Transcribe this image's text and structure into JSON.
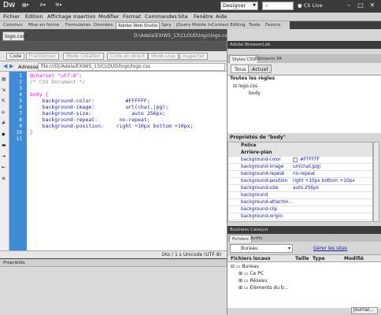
{
  "app": {
    "logo": "Dw",
    "workspace": "Designer",
    "cs_live": "CS Live"
  },
  "menu": [
    "Fichier",
    "Edition",
    "Affichage",
    "Insertion",
    "Modifier",
    "Format",
    "Commandes",
    "Site",
    "Fenêtre",
    "Aide"
  ],
  "insert_tabs": [
    "Commun",
    "Mise en forme",
    "Formulaires",
    "Données",
    "Adobe Web Studio",
    "Spry",
    "jQuery Mobile",
    "InContext Editing",
    "Texte",
    "Favoris"
  ],
  "insert_active_index": 4,
  "document": {
    "tab": "logo.css*",
    "path": "D:\\Adela\\EXIWS_13\\CLOUD\\logo\\logo.css",
    "view_buttons": [
      "Code",
      "Fractionner",
      "Mode Création",
      "Code en direct",
      "Mode Live",
      "Inspecter"
    ],
    "address_label": "Adresse :",
    "address_value": "file:///D|/Adela/EXIWS_13/CLOUD/logo/logo.css",
    "lines": [
      "1",
      "2",
      "3",
      "4",
      "5",
      "6",
      "7",
      "8",
      "9",
      "10",
      "11"
    ],
    "code": {
      "charset": "@charset \"utf-8\";",
      "comment": "/* CSS Document */",
      "selector": "body {",
      "p1": "    background-color:          #FFFFFF;",
      "p2": "    background-image:          url(chat.jpg);",
      "p3": "    background-size:             auto 256px;",
      "p4": "    background-repeat:       no-repeat;",
      "p5": "    background-position:    right +10px bottom +10px;",
      "close": "}"
    },
    "status": "1Ko / 1 s  Unicode (UTF-8)"
  },
  "properties_panel": {
    "title": "Propriétés"
  },
  "right_panel": {
    "browserlab": "Adobe BrowserLab",
    "tabs": [
      "Styles CSS",
      "Éléments PA"
    ],
    "toggle_all": "Tous",
    "toggle_current": "Actuel",
    "rules_title": "Toutes les règles",
    "rule_file": "logo.css",
    "rule_child": "body",
    "props_title": "Propriétés de \"body\"",
    "props": [
      {
        "name": "Police",
        "value": "",
        "cat": true
      },
      {
        "name": "Arrière-plan",
        "value": "",
        "cat": true
      },
      {
        "name": "background-color",
        "value": "#FFFFFF"
      },
      {
        "name": "background-image",
        "value": "url(chat.jpg)"
      },
      {
        "name": "background-repeat",
        "value": "no-repeat"
      },
      {
        "name": "background-position",
        "value": "right +10px bottom +10px"
      },
      {
        "name": "background-size",
        "value": "auto 256px"
      },
      {
        "name": "background",
        "value": ""
      },
      {
        "name": "background-attachm...",
        "value": ""
      },
      {
        "name": "background-clip",
        "value": ""
      },
      {
        "name": "background-origin",
        "value": ""
      }
    ],
    "business_catalyst": "Business Catalyst",
    "files_tabs": [
      "Fichiers",
      "Actifs"
    ],
    "files_select": "Bureau",
    "manage_sites": "Gérer les sites",
    "files_headers": [
      "Fichiers locaux",
      "Taille",
      "Type",
      "Modifié"
    ],
    "tree": [
      "Bureau",
      "Ce PC",
      "Réseau",
      "Éléments du b..."
    ],
    "journal": "Journal..."
  },
  "colors": {
    "code_gutter": "#3f8bd6",
    "selector": "#ff00ff",
    "property": "#1a1aa8",
    "comment": "#888888"
  }
}
